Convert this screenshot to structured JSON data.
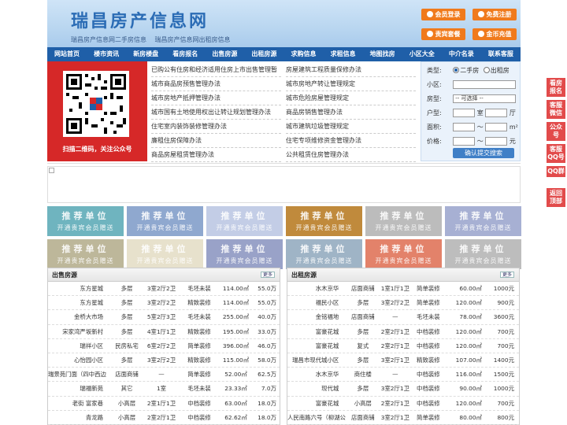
{
  "header": {
    "title": "瑞昌房产信息网",
    "sub_links": [
      "瑞昌房产信息网二手房信息",
      "瑞昌房产信息网出租房信息"
    ],
    "buttons": [
      "会员登录",
      "免费注册",
      "责宾套餐",
      "金币充值"
    ]
  },
  "nav": [
    "网站首页",
    "楼市资讯",
    "新房楼盘",
    "看房报名",
    "出售房源",
    "出租房源",
    "求购信息",
    "求租信息",
    "地图找房",
    "小区大全",
    "中介名录",
    "联系客服"
  ],
  "qr": {
    "caption": "扫描二维码，关注公众号"
  },
  "links_left": [
    "已购公有住房和经济适用住房上市出售管理暂",
    "城市商品房预售管理办法",
    "城市房地产抵押管理办法",
    "城市国有土地使用权出让转让规划管理办法",
    "住宅室内装饰装修管理办法",
    "廉租住房保障办法",
    "商品房屋租赁管理办法"
  ],
  "links_right": [
    "房屋建筑工程质量保修办法",
    "城市房地产转让管理规定",
    "城市危险房屋管理规定",
    "商品房销售管理办法",
    "城市建筑垃圾管理规定",
    "住宅专项维修资金管理办法",
    "公共租赁住房管理办法"
  ],
  "search": {
    "type_label": "类型:",
    "type_opt1": "二手房",
    "type_opt2": "出租房",
    "community_label": "小区:",
    "housetype_label": "房型:",
    "housetype_value": "-- 可选择 --",
    "layout_label": "户型:",
    "room_unit": "室",
    "hall_unit": "厅",
    "area_label": "面积:",
    "area_sep": "～",
    "area_unit": "m²",
    "price_label": "价格:",
    "price_sep": "～",
    "price_unit": "元",
    "submit": "确认提交搜索"
  },
  "ads": {
    "title": "推荐单位",
    "subtitle": "开通贵宾会员赠送",
    "colors": [
      "#6fb4bf",
      "#8fa8cf",
      "#c3cde6",
      "#c08a3c",
      "#bcbcbc",
      "#a7b0d3",
      "#bdb79a",
      "#e7e1cc",
      "#99a2c8",
      "#9fb4c6",
      "#e3826a",
      "#bdbdbd"
    ]
  },
  "sale": {
    "title": "出售房源",
    "more": "更多",
    "rows": [
      [
        "东方星城",
        "多层",
        "3室2厅2卫",
        "毛坯未装",
        "114.00㎡",
        "55.0万"
      ],
      [
        "东方星城",
        "多层",
        "3室2厅2卫",
        "精致装修",
        "114.00㎡",
        "55.0万"
      ],
      [
        "金桥大市场",
        "多层",
        "5室2厅3卫",
        "毛坯未装",
        "255.00㎡",
        "40.0万"
      ],
      [
        "宋家湾严坂新村",
        "多层",
        "4室1厅1卫",
        "精致装修",
        "195.00㎡",
        "33.0万"
      ],
      [
        "瑞祥小区",
        "民房私宅",
        "6室2厅2卫",
        "简单装修",
        "396.00㎡",
        "46.0万"
      ],
      [
        "心怡园小区",
        "多层",
        "3室2厅2卫",
        "精致装修",
        "115.00㎡",
        "58.0万"
      ],
      [
        "瑞景苑门面（四中西边",
        "店面商铺",
        "—",
        "简单装修",
        "52.00㎡",
        "62.5万"
      ],
      [
        "瑞福新苑",
        "其它",
        "1室",
        "毛坯未装",
        "23.33㎡",
        "7.0万"
      ],
      [
        "老街 富家巷",
        "小高层",
        "2室1厅1卫",
        "中档装修",
        "63.00㎡",
        "18.0万"
      ],
      [
        "青龙路",
        "小高层",
        "2室2厅1卫",
        "中档装修",
        "62.62㎡",
        "18.0万"
      ]
    ]
  },
  "rent": {
    "title": "出租房源",
    "more": "更多",
    "rows": [
      [
        "水木京华",
        "店面商铺",
        "1室1厅1卫",
        "简单装修",
        "60.00㎡",
        "1000元"
      ],
      [
        "福民小区",
        "多层",
        "3室2厅2卫",
        "简单装修",
        "120.00㎡",
        "900元"
      ],
      [
        "金铭福地",
        "店面商铺",
        "—",
        "毛坯未装",
        "78.00㎡",
        "3600元"
      ],
      [
        "富豪花城",
        "多层",
        "2室2厅1卫",
        "中档装修",
        "120.00㎡",
        "700元"
      ],
      [
        "富豪花城",
        "复式",
        "2室2厅1卫",
        "中档装修",
        "120.00㎡",
        "700元"
      ],
      [
        "瑞昌市现代城小区",
        "多层",
        "3室2厅1卫",
        "精致装修",
        "107.00㎡",
        "1400元"
      ],
      [
        "水木京华",
        "商住楼",
        "—",
        "中档装修",
        "116.00㎡",
        "1500元"
      ],
      [
        "现代城",
        "多层",
        "3室2厅1卫",
        "中档装修",
        "90.00㎡",
        "1000元"
      ],
      [
        "富豪花城",
        "小高层",
        "2室2厅1卫",
        "中档装修",
        "120.00㎡",
        "700元"
      ],
      [
        "人民南路六号（柳湖公",
        "店面商铺",
        "3室2厅1卫",
        "简单装修",
        "80.00㎡",
        "800元"
      ]
    ]
  },
  "side": [
    "看房报名",
    "客服微信",
    "公众号",
    "客服QQ号",
    "QQ群",
    "返回顶部"
  ]
}
